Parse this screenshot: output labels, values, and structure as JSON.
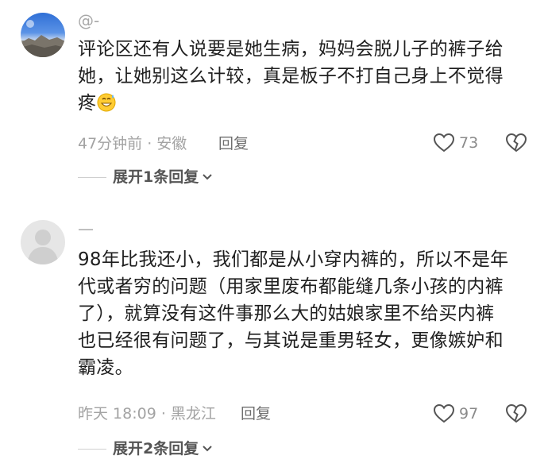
{
  "comments": [
    {
      "username": "@-",
      "avatar": "landscape-avatar",
      "text_lines": [
        "评论区还有人说要是她生病，妈妈会脱儿子的裤子给",
        "她，让她别这么计较，真是板子不打自己身上不觉得",
        "疼"
      ],
      "emoji": "grinning-sweat-emoji",
      "time_location": "47分钟前 · 安徽",
      "reply_label": "回复",
      "like_count": "73",
      "expand_label": "展开1条回复"
    },
    {
      "username": "—",
      "avatar": "default-gray-avatar",
      "text_lines": [
        "98年比我还小，我们都是从小穿内裤的，所以不是年",
        "代或者穷的问题（用家里废布都能缝几条小孩的内裤",
        "了），就算没有这件事那么大的姑娘家里不给买内裤",
        "也已经很有问题了，与其说是重男轻女，更像嫉妒和",
        "霸凌。"
      ],
      "time_location": "昨天 18:09 · 黑龙江",
      "reply_label": "回复",
      "like_count": "97",
      "expand_label": "展开2条回复"
    }
  ],
  "icons": {
    "like": "heart-outline-icon",
    "dislike": "broken-heart-icon",
    "expand": "chevron-down-icon"
  },
  "colors": {
    "text": "#1f1f1f",
    "meta": "#a3a3a3",
    "action": "#6f6f6f"
  }
}
